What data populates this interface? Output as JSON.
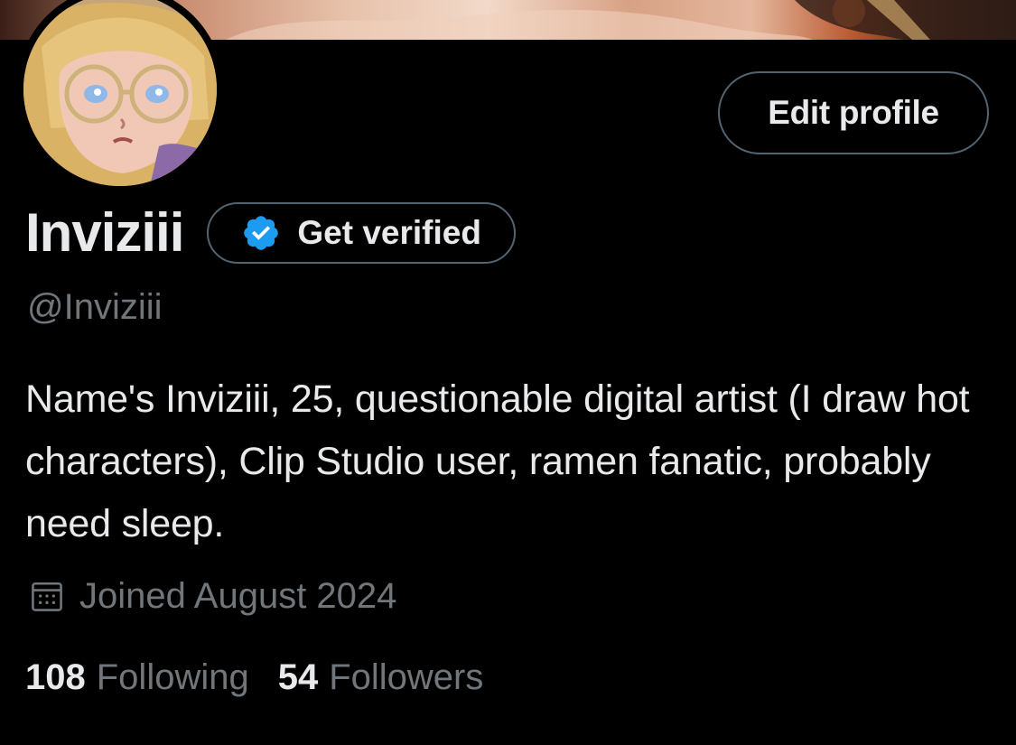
{
  "profile": {
    "display_name": "Inviziii",
    "handle": "@Inviziii",
    "bio": "Name's Inviziii, 25, questionable digital artist (I draw hot characters), Clip Studio user, ramen fanatic, probably need sleep.",
    "joined": "Joined August 2024",
    "following_count": "108",
    "following_label": "Following",
    "followers_count": "54",
    "followers_label": "Followers"
  },
  "actions": {
    "edit_profile_label": "Edit profile",
    "get_verified_label": "Get verified"
  },
  "icons": {
    "verified": "verified-badge-icon",
    "calendar": "calendar-icon"
  },
  "colors": {
    "background": "#000000",
    "text_primary": "#e7e9ea",
    "text_secondary": "#71767b",
    "border": "#536471",
    "verified_blue": "#1d9bf0"
  }
}
